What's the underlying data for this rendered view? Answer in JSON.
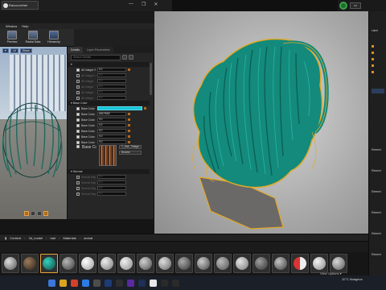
{
  "app": {
    "tab_title": "RaccoonHair",
    "window_controls": [
      "—",
      "❐",
      "✕"
    ],
    "tray_box_text": "8/8"
  },
  "menu": {
    "items": [
      "Window",
      "Help"
    ]
  },
  "toolbar": {
    "buttons": [
      {
        "label": "Preview",
        "icon": "preview-icon"
      },
      {
        "label": "Radial Data",
        "icon": "radial-data-icon"
      },
      {
        "label": "Hierarchy",
        "icon": "hierarchy-icon"
      }
    ]
  },
  "left_viewport": {
    "buttons": [
      "Lit",
      "Show"
    ]
  },
  "details": {
    "tabs": [
      "Details",
      "Layer Parameters"
    ],
    "search_placeholder": "Search Details",
    "section_groups": [
      {
        "rows": [
          {
            "label": "Alt Integer S.",
            "value": "0.0",
            "checked": true,
            "dim": false
          },
          {
            "label": "Alt Integer L.",
            "value": "0.0",
            "checked": false,
            "dim": true
          },
          {
            "label": "Alt Integer",
            "value": "0.0",
            "checked": false,
            "dim": true
          },
          {
            "label": "Alt Integer",
            "value": "0.0",
            "checked": false,
            "dim": true
          },
          {
            "label": "Alt Integer",
            "value": "0.0",
            "checked": false,
            "dim": true
          },
          {
            "label": "Alt Integer",
            "value": "0.0",
            "checked": false,
            "dim": true
          }
        ]
      },
      {
        "title": "Base Color",
        "rows": [
          {
            "label": "Base Color",
            "value": "",
            "checked": true,
            "cyan": true
          },
          {
            "label": "Base Color",
            "value": "A81F8AB",
            "checked": true
          },
          {
            "label": "Base Color",
            "value": "0.0",
            "checked": true
          },
          {
            "label": "Base Color",
            "value": "0.0",
            "checked": true
          },
          {
            "label": "Base Color",
            "value": "0.0",
            "checked": true
          },
          {
            "label": "Base Color",
            "value": "0.0",
            "checked": true
          },
          {
            "label": "Base Color",
            "value": "0.0",
            "checked": true
          }
        ]
      },
      {
        "title": "Normal",
        "rows": [
          {
            "label": "Normal Map",
            "value": "0.0",
            "checked": false,
            "dim": true
          },
          {
            "label": "Normal Map",
            "value": "0.0",
            "checked": false,
            "dim": true
          },
          {
            "label": "Normal Map",
            "value": "0.0",
            "checked": false,
            "dim": true
          },
          {
            "label": "Normal Map",
            "value": "0.0",
            "checked": false,
            "dim": true
          }
        ]
      }
    ],
    "texture": {
      "label": "Base Color",
      "buttons": [
        "T_Hair_Tintage",
        "Browse"
      ]
    }
  },
  "content_browser": {
    "breadcrumbs": [
      "Content",
      "3d_model",
      "hair",
      "Materials",
      "unreal"
    ],
    "view_options": "View Options ▾"
  },
  "right_panel": {
    "labels": [
      "Label",
      "Element",
      "Element",
      "Element",
      "Element",
      "Element",
      "Element"
    ]
  },
  "taskbar": {
    "weather": "11°C Nuageux",
    "time": "—"
  },
  "colors": {
    "hair": "#138a7c",
    "hair_outline": "#e3a826",
    "accent": "#17c2d6",
    "selection": "#e6a23c"
  }
}
